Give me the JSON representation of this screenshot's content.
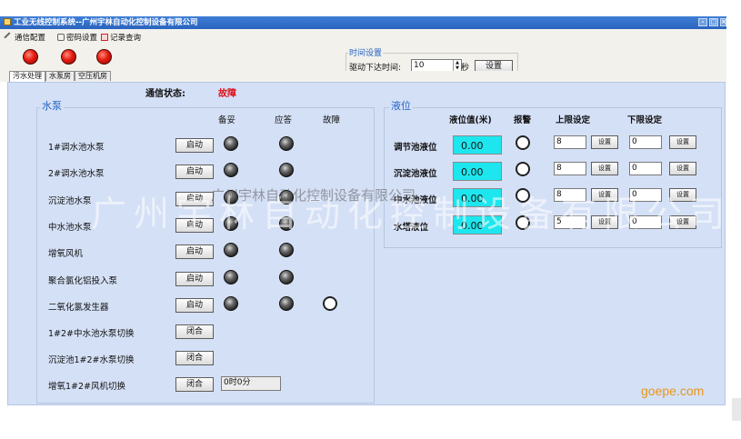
{
  "window": {
    "title": "工业无线控制系统--广州宇林自动化控制设备有限公司",
    "min": "-",
    "max": "□",
    "close": "×"
  },
  "menu": [
    {
      "label": "通信配置",
      "icon": "wrench-icon"
    },
    {
      "label": "密码设置",
      "icon": "lock-icon"
    },
    {
      "label": "记录查询",
      "icon": "record-icon"
    }
  ],
  "time_settings": {
    "group_label": "时间设置",
    "field_label": "驱动下达时间:",
    "value": "10",
    "unit": "秒",
    "button": "设置"
  },
  "tabs": [
    "污水处理",
    "水泵房",
    "空压机房"
  ],
  "status": {
    "label": "通信状态:",
    "value": "故障"
  },
  "pumps": {
    "title": "水泵",
    "headers": [
      "备妥",
      "应答",
      "故障"
    ],
    "rows": [
      {
        "name": "1#调水池水泵",
        "button": "启动"
      },
      {
        "name": "2#调水池水泵",
        "button": "启动"
      },
      {
        "name": "沉淀池水泵",
        "button": "启动"
      },
      {
        "name": "中水池水泵",
        "button": "启动"
      },
      {
        "name": "增氧风机",
        "button": "启动"
      },
      {
        "name": "聚合氯化铝投入泵",
        "button": "启动"
      },
      {
        "name": "二氧化氯发生器",
        "button": "启动"
      },
      {
        "name": "1#2#中水池水泵切换",
        "button": "闭合"
      },
      {
        "name": "沉淀池1#2#水泵切换",
        "button": "闭合"
      },
      {
        "name": "增氧1#2#风机切换",
        "button": "闭合"
      }
    ],
    "timer": "0时0分"
  },
  "levels": {
    "title": "液位",
    "headers": [
      "液位值(米)",
      "报警",
      "上限设定",
      "下限设定"
    ],
    "rows": [
      {
        "name": "调节池液位",
        "value": "0.00",
        "upper": "8",
        "lower": "0",
        "button": "设置"
      },
      {
        "name": "沉淀池液位",
        "value": "0.00",
        "upper": "8",
        "lower": "0",
        "button": "设置"
      },
      {
        "name": "中水池液位",
        "value": "0.00",
        "upper": "8",
        "lower": "0",
        "button": "设置"
      },
      {
        "name": "水塔液位",
        "value": "0.00",
        "upper": "5",
        "lower": "0",
        "button": "设置"
      }
    ]
  },
  "watermark": {
    "large": "广州宇林自动化控制设备有限公司",
    "small": "广州宇林自动化控制设备有限公司"
  },
  "site_mark": "goepe.com",
  "colors": {
    "accent": "#2563c2",
    "fault": "#e0101a",
    "level_box": "#1ee6ee",
    "panel": "#d4e0f6"
  }
}
